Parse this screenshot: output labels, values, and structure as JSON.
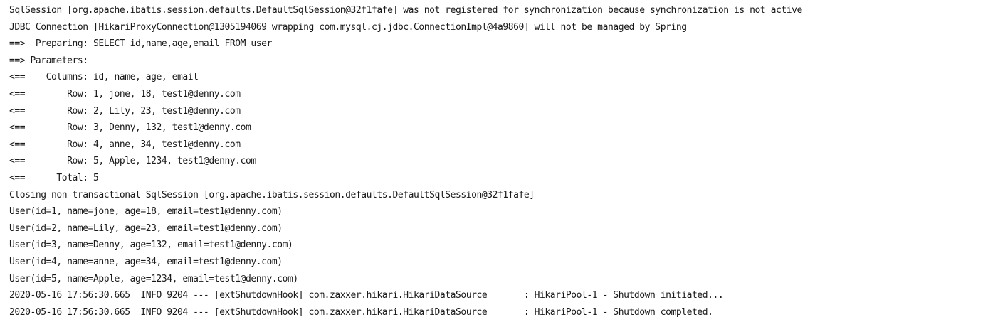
{
  "console": {
    "lines": [
      "SqlSession [org.apache.ibatis.session.defaults.DefaultSqlSession@32f1fafe] was not registered for synchronization because synchronization is not active",
      "JDBC Connection [HikariProxyConnection@1305194069 wrapping com.mysql.cj.jdbc.ConnectionImpl@4a9860] will not be managed by Spring",
      "==>  Preparing: SELECT id,name,age,email FROM user",
      "==> Parameters: ",
      "<==    Columns: id, name, age, email",
      "<==        Row: 1, jone, 18, test1@denny.com",
      "<==        Row: 2, Lily, 23, test1@denny.com",
      "<==        Row: 3, Denny, 132, test1@denny.com",
      "<==        Row: 4, anne, 34, test1@denny.com",
      "<==        Row: 5, Apple, 1234, test1@denny.com",
      "<==      Total: 5",
      "Closing non transactional SqlSession [org.apache.ibatis.session.defaults.DefaultSqlSession@32f1fafe]",
      "User(id=1, name=jone, age=18, email=test1@denny.com)",
      "User(id=2, name=Lily, age=23, email=test1@denny.com)",
      "User(id=3, name=Denny, age=132, email=test1@denny.com)",
      "User(id=4, name=anne, age=34, email=test1@denny.com)",
      "User(id=5, name=Apple, age=1234, email=test1@denny.com)",
      "2020-05-16 17:56:30.665  INFO 9204 --- [extShutdownHook] com.zaxxer.hikari.HikariDataSource       : HikariPool-1 - Shutdown initiated...",
      "2020-05-16 17:56:30.665  INFO 9204 --- [extShutdownHook] com.zaxxer.hikari.HikariDataSource       : HikariPool-1 - Shutdown completed."
    ]
  }
}
